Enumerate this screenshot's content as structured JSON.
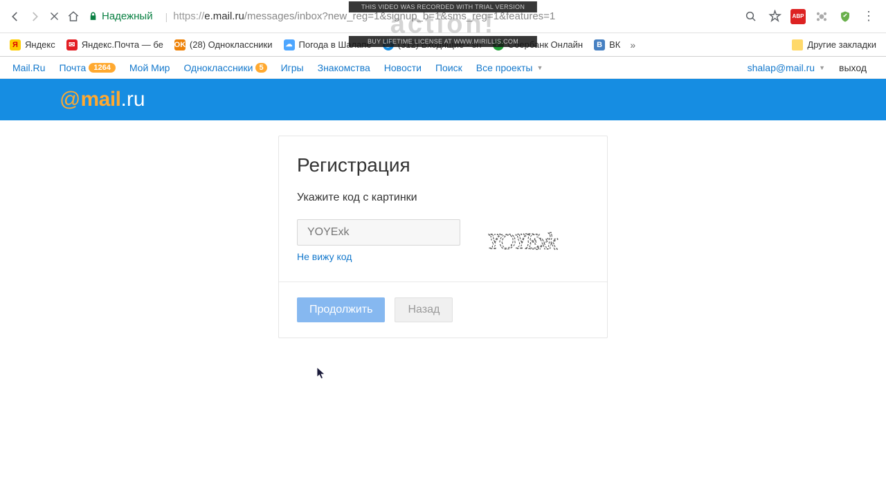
{
  "browser": {
    "secure_label": "Надежный",
    "url_proto": "https://",
    "url_domain": "e.mail.ru",
    "url_path": "/messages/inbox?new_reg=1&signup_b=1&sms_reg=1&features=1"
  },
  "bookmarks": [
    {
      "label": "Яндекс"
    },
    {
      "label": "Яндекс.Почта — бе"
    },
    {
      "label": "(28) Одноклассники"
    },
    {
      "label": "Погода в Шалапе"
    },
    {
      "label": "(312) Входящие - sh"
    },
    {
      "label": "Сбербанк Онлайн"
    },
    {
      "label": "ВК"
    }
  ],
  "bookmarks_other": "Другие закладки",
  "portal": {
    "links": [
      {
        "label": "Mail.Ru"
      },
      {
        "label": "Почта",
        "badge": "1264"
      },
      {
        "label": "Мой Мир"
      },
      {
        "label": "Одноклассники",
        "badge": "5"
      },
      {
        "label": "Игры"
      },
      {
        "label": "Знакомства"
      },
      {
        "label": "Новости"
      },
      {
        "label": "Поиск"
      },
      {
        "label": "Все проекты",
        "caret": true
      }
    ],
    "user_email": "shalap@mail.ru",
    "logout": "выход"
  },
  "registration": {
    "title": "Регистрация",
    "subtitle": "Укажите код с картинки",
    "captcha_placeholder": "YOYExk",
    "cant_see": "Не вижу код",
    "captcha_text": "YOYExk",
    "continue_btn": "Продолжить",
    "back_btn": "Назад"
  },
  "overlay": {
    "line1": "THIS VIDEO WAS RECORDED WITH TRIAL VERSION",
    "line2": "BUY LIFETIME LICENSE AT WWW.MIRILLIS.COM"
  }
}
